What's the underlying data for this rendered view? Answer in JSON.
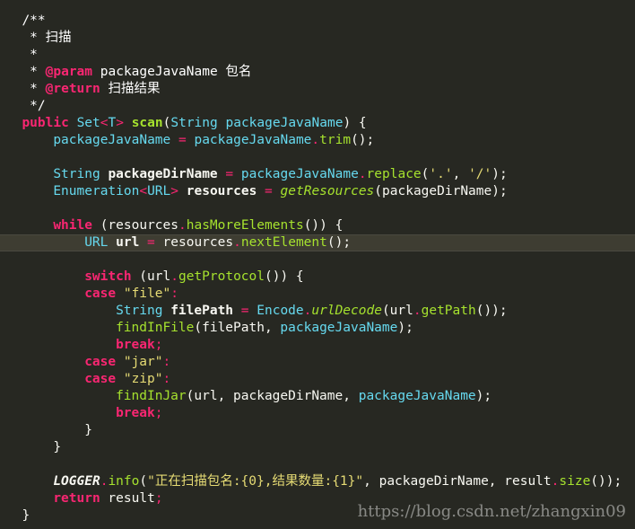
{
  "editor": {
    "lines": [
      {
        "indent": 2,
        "tokens": [
          {
            "t": "/**",
            "c": "comment"
          }
        ]
      },
      {
        "indent": 2,
        "tokens": [
          {
            "t": " * 扫描",
            "c": "comment"
          }
        ]
      },
      {
        "indent": 2,
        "tokens": [
          {
            "t": " *",
            "c": "comment"
          }
        ]
      },
      {
        "indent": 2,
        "tokens": [
          {
            "t": " * ",
            "c": "comment"
          },
          {
            "t": "@param",
            "c": "doctag"
          },
          {
            "t": " packageJavaName 包名",
            "c": "comment"
          }
        ]
      },
      {
        "indent": 2,
        "tokens": [
          {
            "t": " * ",
            "c": "comment"
          },
          {
            "t": "@return",
            "c": "doctag"
          },
          {
            "t": " 扫描结果",
            "c": "comment"
          }
        ]
      },
      {
        "indent": 2,
        "tokens": [
          {
            "t": " */",
            "c": "comment"
          }
        ]
      },
      {
        "indent": 2,
        "tokens": [
          {
            "t": "public",
            "c": "kw"
          },
          {
            "t": " ",
            "c": "plain"
          },
          {
            "t": "Set",
            "c": "type"
          },
          {
            "t": "<",
            "c": "op"
          },
          {
            "t": "T",
            "c": "type"
          },
          {
            "t": ">",
            "c": "op"
          },
          {
            "t": " ",
            "c": "plain"
          },
          {
            "t": "scan",
            "c": "fn"
          },
          {
            "t": "(",
            "c": "punct"
          },
          {
            "t": "String",
            "c": "type"
          },
          {
            "t": " ",
            "c": "plain"
          },
          {
            "t": "packageJavaName",
            "c": "field"
          },
          {
            "t": ") {",
            "c": "punct"
          }
        ]
      },
      {
        "indent": 6,
        "tokens": [
          {
            "t": "packageJavaName",
            "c": "field"
          },
          {
            "t": " = ",
            "c": "op"
          },
          {
            "t": "packageJavaName",
            "c": "field"
          },
          {
            "t": ".",
            "c": "op"
          },
          {
            "t": "trim",
            "c": "method"
          },
          {
            "t": "();",
            "c": "punct"
          }
        ]
      },
      {
        "indent": 0,
        "tokens": []
      },
      {
        "indent": 6,
        "tokens": [
          {
            "t": "String",
            "c": "type"
          },
          {
            "t": " ",
            "c": "plain"
          },
          {
            "t": "packageDirName",
            "c": "local"
          },
          {
            "t": " = ",
            "c": "op"
          },
          {
            "t": "packageJavaName",
            "c": "field"
          },
          {
            "t": ".",
            "c": "op"
          },
          {
            "t": "replace",
            "c": "method"
          },
          {
            "t": "(",
            "c": "punct"
          },
          {
            "t": "'.'",
            "c": "string"
          },
          {
            "t": ", ",
            "c": "punct"
          },
          {
            "t": "'/'",
            "c": "string"
          },
          {
            "t": ");",
            "c": "punct"
          }
        ]
      },
      {
        "indent": 6,
        "tokens": [
          {
            "t": "Enumeration",
            "c": "type"
          },
          {
            "t": "<",
            "c": "op"
          },
          {
            "t": "URL",
            "c": "type"
          },
          {
            "t": ">",
            "c": "op"
          },
          {
            "t": " ",
            "c": "plain"
          },
          {
            "t": "resources",
            "c": "local"
          },
          {
            "t": " = ",
            "c": "op"
          },
          {
            "t": "getResources",
            "c": "static"
          },
          {
            "t": "(packageDirName);",
            "c": "punct"
          }
        ]
      },
      {
        "indent": 0,
        "tokens": []
      },
      {
        "indent": 6,
        "tokens": [
          {
            "t": "while",
            "c": "kw"
          },
          {
            "t": " (resources",
            "c": "punct"
          },
          {
            "t": ".",
            "c": "op"
          },
          {
            "t": "hasMoreElements",
            "c": "method"
          },
          {
            "t": "()) {",
            "c": "punct"
          }
        ]
      },
      {
        "indent": 10,
        "current": true,
        "tokens": [
          {
            "t": "URL",
            "c": "type"
          },
          {
            "t": " ",
            "c": "plain"
          },
          {
            "t": "url",
            "c": "local"
          },
          {
            "t": " = ",
            "c": "op"
          },
          {
            "t": "resources",
            "c": "plain"
          },
          {
            "t": ".",
            "c": "op"
          },
          {
            "t": "nextElement",
            "c": "method"
          },
          {
            "t": "();",
            "c": "punct"
          }
        ]
      },
      {
        "indent": 0,
        "tokens": []
      },
      {
        "indent": 10,
        "tokens": [
          {
            "t": "switch",
            "c": "kw"
          },
          {
            "t": " (url",
            "c": "punct"
          },
          {
            "t": ".",
            "c": "op"
          },
          {
            "t": "getProtocol",
            "c": "method"
          },
          {
            "t": "()) {",
            "c": "punct"
          }
        ]
      },
      {
        "indent": 10,
        "tokens": [
          {
            "t": "case",
            "c": "kw"
          },
          {
            "t": " ",
            "c": "plain"
          },
          {
            "t": "\"file\"",
            "c": "string"
          },
          {
            "t": ":",
            "c": "op"
          }
        ]
      },
      {
        "indent": 14,
        "tokens": [
          {
            "t": "String",
            "c": "type"
          },
          {
            "t": " ",
            "c": "plain"
          },
          {
            "t": "filePath",
            "c": "local"
          },
          {
            "t": " = ",
            "c": "op"
          },
          {
            "t": "Encode",
            "c": "type"
          },
          {
            "t": ".",
            "c": "op"
          },
          {
            "t": "urlDecode",
            "c": "static"
          },
          {
            "t": "(url",
            "c": "punct"
          },
          {
            "t": ".",
            "c": "op"
          },
          {
            "t": "getPath",
            "c": "method"
          },
          {
            "t": "());",
            "c": "punct"
          }
        ]
      },
      {
        "indent": 14,
        "tokens": [
          {
            "t": "findInFile",
            "c": "method"
          },
          {
            "t": "(filePath, ",
            "c": "punct"
          },
          {
            "t": "packageJavaName",
            "c": "field"
          },
          {
            "t": ");",
            "c": "punct"
          }
        ]
      },
      {
        "indent": 14,
        "tokens": [
          {
            "t": "break",
            "c": "kw"
          },
          {
            "t": ";",
            "c": "op"
          }
        ]
      },
      {
        "indent": 10,
        "tokens": [
          {
            "t": "case",
            "c": "kw"
          },
          {
            "t": " ",
            "c": "plain"
          },
          {
            "t": "\"jar\"",
            "c": "string"
          },
          {
            "t": ":",
            "c": "op"
          }
        ]
      },
      {
        "indent": 10,
        "tokens": [
          {
            "t": "case",
            "c": "kw"
          },
          {
            "t": " ",
            "c": "plain"
          },
          {
            "t": "\"zip\"",
            "c": "string"
          },
          {
            "t": ":",
            "c": "op"
          }
        ]
      },
      {
        "indent": 14,
        "tokens": [
          {
            "t": "findInJar",
            "c": "method"
          },
          {
            "t": "(url, packageDirName, ",
            "c": "punct"
          },
          {
            "t": "packageJavaName",
            "c": "field"
          },
          {
            "t": ");",
            "c": "punct"
          }
        ]
      },
      {
        "indent": 14,
        "tokens": [
          {
            "t": "break",
            "c": "kw"
          },
          {
            "t": ";",
            "c": "op"
          }
        ]
      },
      {
        "indent": 10,
        "tokens": [
          {
            "t": "}",
            "c": "punct"
          }
        ]
      },
      {
        "indent": 6,
        "tokens": [
          {
            "t": "}",
            "c": "punct"
          }
        ]
      },
      {
        "indent": 0,
        "tokens": []
      },
      {
        "indent": 6,
        "tokens": [
          {
            "t": "LOGGER",
            "c": "logger"
          },
          {
            "t": ".",
            "c": "op"
          },
          {
            "t": "info",
            "c": "method"
          },
          {
            "t": "(",
            "c": "punct"
          },
          {
            "t": "\"正在扫描包名:{0},结果数量:{1}\"",
            "c": "string"
          },
          {
            "t": ", packageDirName, result",
            "c": "punct"
          },
          {
            "t": ".",
            "c": "op"
          },
          {
            "t": "size",
            "c": "method"
          },
          {
            "t": "());",
            "c": "punct"
          }
        ]
      },
      {
        "indent": 6,
        "tokens": [
          {
            "t": "return",
            "c": "kw"
          },
          {
            "t": " result",
            "c": "punct"
          },
          {
            "t": ";",
            "c": "op"
          }
        ]
      },
      {
        "indent": 2,
        "tokens": [
          {
            "t": "}",
            "c": "punct"
          }
        ]
      }
    ]
  },
  "watermark": {
    "text": "https://blog.csdn.net/zhangxin09"
  },
  "colors": {
    "background": "#272822",
    "current_line": "#3e3d32",
    "keyword": "#f92672",
    "type": "#66d9ef",
    "method": "#a6e22e",
    "string": "#e6db74",
    "plain": "#f8f8f2",
    "comment": "#ffffff"
  }
}
